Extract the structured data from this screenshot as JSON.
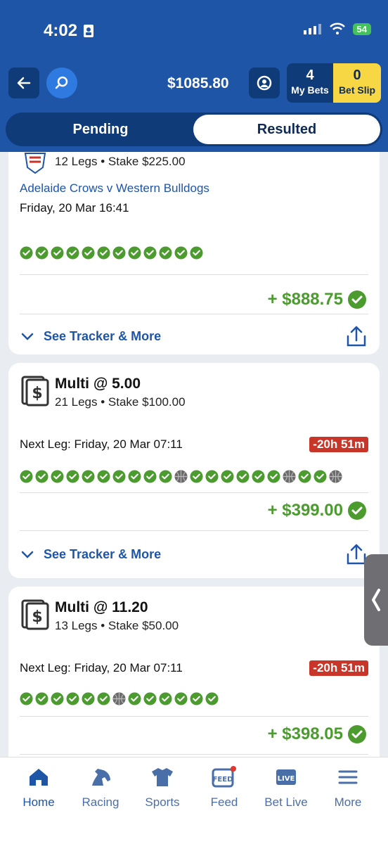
{
  "status_bar": {
    "time": "4:02",
    "battery": "54"
  },
  "header": {
    "balance": "$1085.80",
    "my_bets_count": "4",
    "my_bets_label": "My Bets",
    "bet_slip_count": "0",
    "bet_slip_label": "Bet Slip"
  },
  "tabs": {
    "pending": "Pending",
    "resulted": "Resulted"
  },
  "bets": [
    {
      "sub": "12 Legs • Stake $225.00",
      "match": "Adelaide Crows v Western Bulldogs",
      "date": "Friday, 20 Mar 16:41",
      "legs": [
        "won",
        "won",
        "won",
        "won",
        "won",
        "won",
        "won",
        "won",
        "won",
        "won",
        "won",
        "won"
      ],
      "payout": "+ $888.75",
      "tracker": "See Tracker & More"
    },
    {
      "title": "Multi @ 5.00",
      "sub": "21 Legs • Stake $100.00",
      "next_leg": "Next Leg: Friday, 20 Mar 07:11",
      "timer": "-20h 51m",
      "legs": [
        "won",
        "won",
        "won",
        "won",
        "won",
        "won",
        "won",
        "won",
        "won",
        "won",
        "wont",
        "won",
        "won",
        "won",
        "won",
        "won",
        "won",
        "wont",
        "won",
        "won",
        "wont"
      ],
      "payout": "+ $399.00",
      "tracker": "See Tracker & More"
    },
    {
      "title": "Multi @ 11.20",
      "sub": "13 Legs • Stake $50.00",
      "next_leg": "Next Leg: Friday, 20 Mar 07:11",
      "timer": "-20h 51m",
      "legs": [
        "won",
        "won",
        "won",
        "won",
        "won",
        "won",
        "wont",
        "won",
        "won",
        "won",
        "won",
        "won",
        "won"
      ],
      "payout": "+ $398.05"
    }
  ],
  "nav": [
    {
      "label": "Home",
      "icon": "home-icon"
    },
    {
      "label": "Racing",
      "icon": "horse-icon"
    },
    {
      "label": "Sports",
      "icon": "jersey-icon"
    },
    {
      "label": "Feed",
      "icon": "feed-icon",
      "icon_text": "FEED"
    },
    {
      "label": "Bet Live",
      "icon": "live-icon",
      "icon_text": "LIVE"
    },
    {
      "label": "More",
      "icon": "menu-icon"
    }
  ],
  "colors": {
    "brand": "#1f55a6",
    "dark": "#0f3b78",
    "win": "#4b9b2f",
    "alert": "#c8362a",
    "betslip": "#f8d745"
  }
}
